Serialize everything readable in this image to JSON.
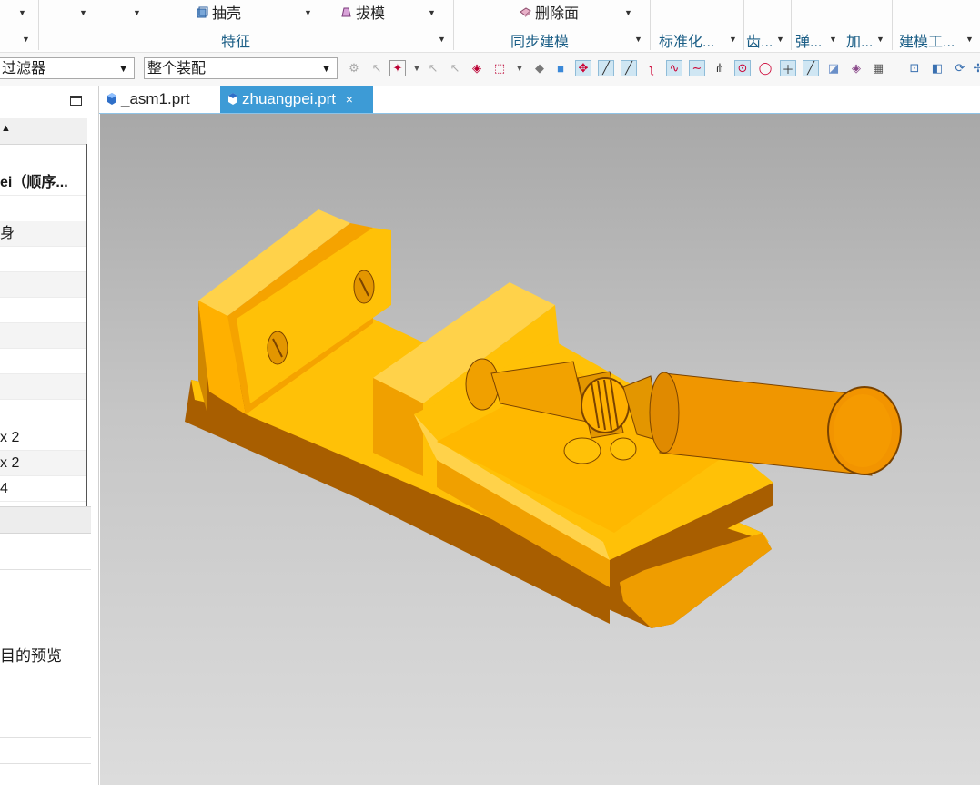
{
  "ribbon": {
    "shell_label": "抽壳",
    "draft_label": "拔模",
    "delete_face_label": "删除面",
    "group_feature": "特征",
    "group_sync": "同步建模",
    "group_standard": "标准化...",
    "group_gear": "齿...",
    "group_spring": "弹...",
    "group_add": "加...",
    "group_tools": "建模工..."
  },
  "toolbar": {
    "filter_value": "过滤器",
    "assembly_value": "整个装配"
  },
  "left_panel": {
    "rows": [
      "ei（顺序...",
      "身",
      "",
      "",
      "",
      "",
      "",
      "x 2",
      "x 2",
      "4"
    ],
    "preview_label": "目的预览"
  },
  "tabs": [
    {
      "label": "_asm1.prt",
      "active": false
    },
    {
      "label": "zhuangpei.prt",
      "active": true,
      "close": "×"
    }
  ],
  "colors": {
    "accent": "#3d9bd6",
    "part_main": "#ffc107",
    "part_shadow": "#a85e00",
    "part_mid": "#f0a800"
  }
}
